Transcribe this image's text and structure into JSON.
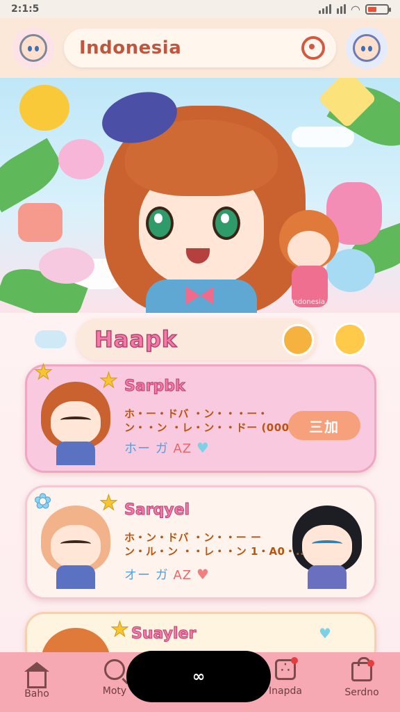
{
  "status_bar": {
    "time": "2:1:5"
  },
  "header": {
    "title": "Indonesia"
  },
  "hero": {
    "watermark": "Indonesia"
  },
  "section": {
    "title": "Haapk"
  },
  "cards": [
    {
      "name": "Sarpbk",
      "desc_line1": "ホ・ー・ドバ ・ン・・・ー・",
      "desc_line2": "ン・・ン ・レ・ン・・ドー (000)..",
      "meta_left": "ホー",
      "meta_mid": "ガ",
      "meta_right": "AZ",
      "button_label": "三加"
    },
    {
      "name": "Sarqyel",
      "desc_line1": "ホ・ン・ドバ ・ン・・ー ー",
      "desc_line2": "ン・ル・ン ・・レ・・ン 1・A0・..",
      "meta_left": "オー",
      "meta_mid": "ガ",
      "meta_right": "AZ"
    },
    {
      "name": "Suayler"
    }
  ],
  "nav": {
    "items": [
      {
        "label": "Baho",
        "icon": "home-icon"
      },
      {
        "label": "Moty",
        "icon": "search-icon"
      },
      {
        "label": "Inapda",
        "icon": "dice-icon"
      },
      {
        "label": "Serdno",
        "icon": "bag-icon"
      }
    ],
    "center_glyph": "∞"
  }
}
